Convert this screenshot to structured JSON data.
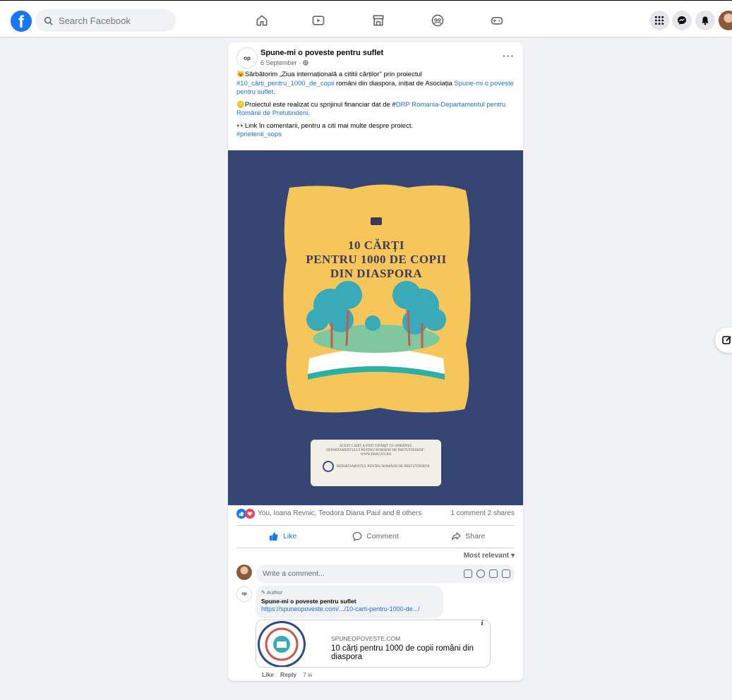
{
  "topbar": {
    "search_placeholder": "Search Facebook"
  },
  "post": {
    "page_name": "Spune-mi o poveste pentru suflet",
    "date": "6 September · ",
    "more_label": "···",
    "avatar_text": "op",
    "text": {
      "p1_emoji": "😺",
      "p1_a": "Sărbătorim „Ziua internațională a cititii cărților\" prin proiectul ",
      "p1_hashtag": "#10_cărți_pentru_1000_de_copii",
      "p1_b": " români din diaspora, inițiat de Asociația ",
      "p1_link": "Spune-mi o poveste pentru suflet",
      "p1_c": ".",
      "p2_emoji": "🪙",
      "p2_a": "Proiectul este realizat cu sprijinul financiar dat de #",
      "p2_link": "DRP Romania-Departamentul pentru Românii de Pretutindeni",
      "p2_c": ".",
      "p3_emoji": "👀",
      "p3_a": "Link în comentarii, pentru a citi mai multe despre proiect.",
      "p3_hashtag": "#prietenii_sops"
    },
    "poster": {
      "line1": "10 CĂRȚI",
      "line2": "PENTRU 1000 DE COPII",
      "line3": "DIN DIASPORA",
      "note_line1": "ACEST CAIET A FOST TIPĂRIT CU SPRIJINUL",
      "note_line2": "DEPARTAMENTULUI PENTRU ROMÂNII DE PRETUTINDENI\".",
      "note_line3": "WWW.DRP.GOV.RO",
      "note_org": "DEPARTAMENTUL PENTRU ROMÂNII DE PRETUTINDENI"
    },
    "reactions": {
      "who": "You, Ioana Revnic, Teodora Diana Paul and 8 others",
      "stats": "1 comment  2 shares"
    },
    "actions": {
      "like": "Like",
      "comment": "Comment",
      "share": "Share"
    },
    "sort_label": "Most relevant",
    "comment_placeholder": "Write a comment...",
    "comment": {
      "author_badge": "Author",
      "name": "Spune-mi o poveste pentru suflet",
      "link": "https://spuneopoveste.com/.../10-carti-pentru-1000-de.../",
      "avatar_text": "op",
      "card_domain": "SPUNEOPOVESTE.COM",
      "card_title": "10 cărți pentru 1000 de copii români din diaspora",
      "info": "i",
      "like": "Like",
      "reply": "Reply",
      "time": "7 w"
    }
  },
  "colors": {
    "brand": "#1877f2",
    "link": "#216fdb",
    "media_bg": "#354675",
    "poster_yellow": "#f6c65b"
  }
}
